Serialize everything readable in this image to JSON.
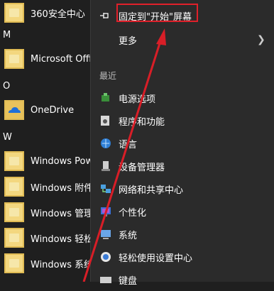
{
  "app_list": {
    "items": [
      {
        "label": "360安全中心",
        "kind": "app"
      },
      {
        "letter": "M"
      },
      {
        "label": "Microsoft Office",
        "kind": "app"
      },
      {
        "letter": "O"
      },
      {
        "label": "OneDrive",
        "kind": "onedrive"
      },
      {
        "letter": "W"
      },
      {
        "label": "Windows Powe",
        "kind": "folder"
      },
      {
        "label": "Windows 附件",
        "kind": "folder"
      },
      {
        "label": "Windows 管理",
        "kind": "folder"
      },
      {
        "label": "Windows 轻松",
        "kind": "folder"
      },
      {
        "label": "Windows 系统",
        "kind": "folder"
      }
    ]
  },
  "context_menu": {
    "pin_label": "固定到\"开始\"屏幕",
    "more_label": "更多",
    "recent_label": "最近",
    "recent_items": [
      {
        "label": "电源选项",
        "icon": "power-options-icon"
      },
      {
        "label": "程序和功能",
        "icon": "programs-features-icon"
      },
      {
        "label": "语言",
        "icon": "language-icon"
      },
      {
        "label": "设备管理器",
        "icon": "device-manager-icon"
      },
      {
        "label": "网络和共享中心",
        "icon": "network-sharing-icon"
      },
      {
        "label": "个性化",
        "icon": "personalization-icon"
      },
      {
        "label": "系统",
        "icon": "system-icon"
      },
      {
        "label": "轻松使用设置中心",
        "icon": "ease-of-access-icon"
      },
      {
        "label": "键盘",
        "icon": "keyboard-icon"
      }
    ]
  },
  "colors": {
    "highlight": "#e0202a",
    "menu_bg": "#2b2b2b",
    "list_bg": "#1f1f1f",
    "tile": "#f3d77f"
  }
}
